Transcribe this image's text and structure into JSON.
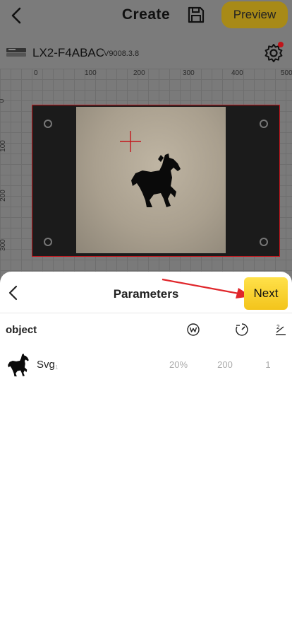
{
  "header": {
    "title": "Create",
    "preview_label": "Preview"
  },
  "device": {
    "name": "LX2-F4ABAC",
    "version": "V9008.3.8"
  },
  "ruler": {
    "top_ticks": [
      "0",
      "100",
      "200",
      "300",
      "400",
      "500"
    ],
    "left_ticks": [
      "0",
      "100",
      "200",
      "300"
    ]
  },
  "sheet": {
    "title": "Parameters",
    "next_label": "Next",
    "column_object": "object",
    "columns": [
      {
        "icon": "power-w-icon"
      },
      {
        "icon": "speed-gauge-icon"
      },
      {
        "icon": "passes-icon"
      }
    ],
    "rows": [
      {
        "name": "Svg",
        "sub": "1",
        "power": "20%",
        "speed": "200",
        "passes": "1"
      }
    ]
  },
  "colors": {
    "accent": "#f5c518",
    "preview_dim": "#a88a17",
    "workarea_border": "#c4161c",
    "annotation_arrow": "#e0262b"
  }
}
